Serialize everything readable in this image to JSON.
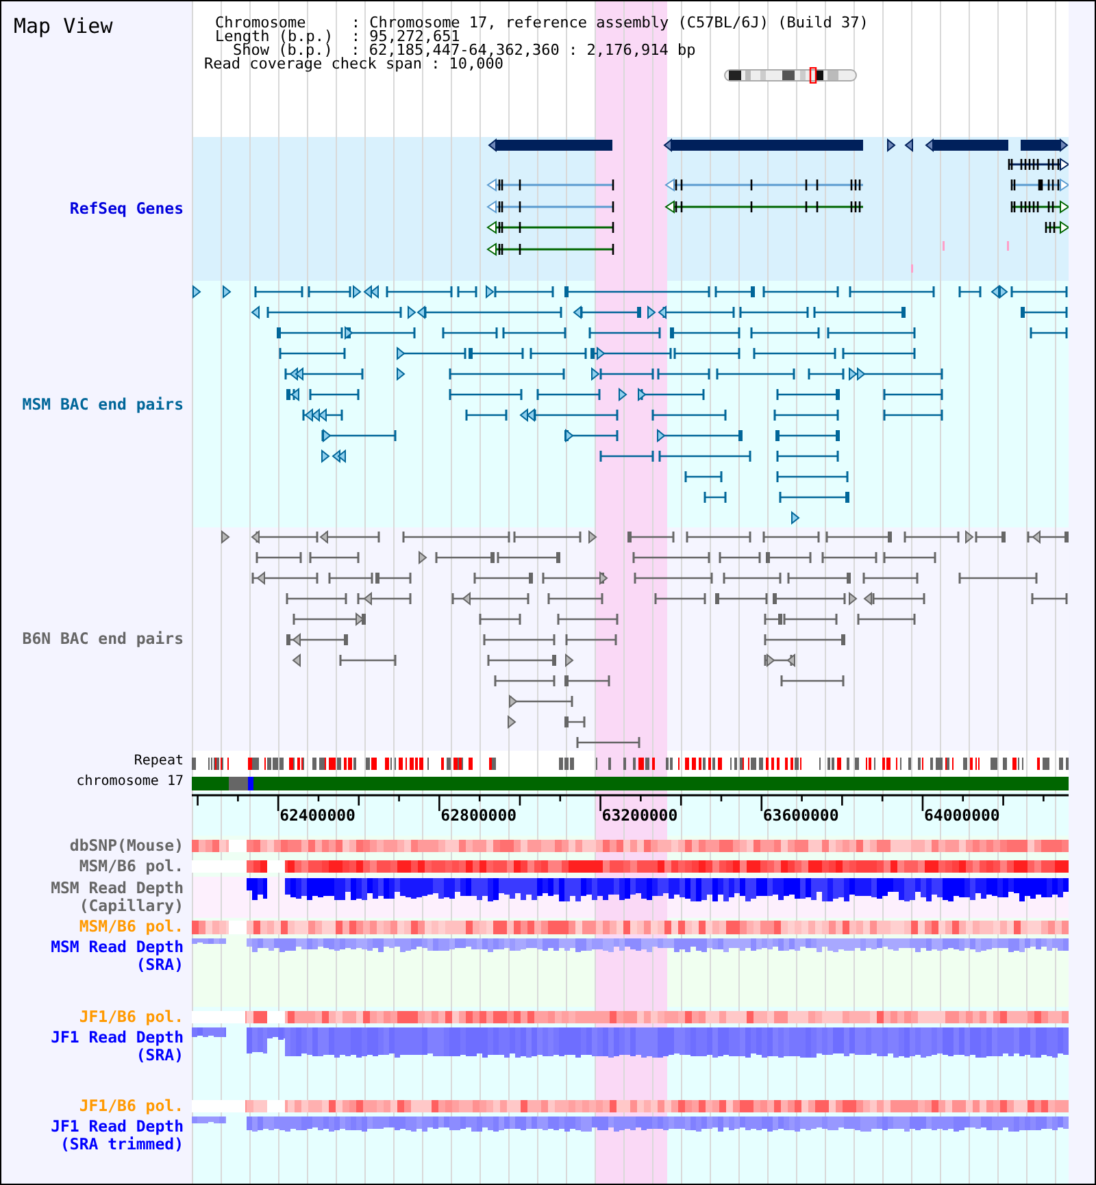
{
  "title": "Map View",
  "info": [
    "Chromosome     : Chromosome 17, reference assembly (C57BL/6J) (Build 37)",
    "Length (b.p.)  : 95,272,651",
    "Show (b.p.)  : 62,185,447-64,362,360 : 2,176,914 bp",
    "Read coverage check span : 10,000"
  ],
  "tracks": [
    {
      "kind": "genes",
      "label": "RefSeq Genes",
      "color": "#0000dd",
      "bold": true
    },
    {
      "kind": "pairs",
      "label": "MSM BAC end pairs",
      "color": "#006699",
      "bold": true
    },
    {
      "kind": "pairs",
      "label": "B6N BAC end pairs",
      "color": "#666666",
      "bold": true
    },
    {
      "kind": "repeat",
      "label": "Repeat",
      "color": "#000000",
      "bold": false
    },
    {
      "kind": "chromosome",
      "label": "chromosome 17",
      "color": "#000000",
      "bold": false
    },
    {
      "kind": "axis",
      "ticks": [
        "62400000",
        "62800000",
        "63200000",
        "63600000",
        "64000000"
      ]
    },
    {
      "kind": "heatmap",
      "label": "dbSNP(Mouse)",
      "color": "#666666",
      "bold": true
    },
    {
      "kind": "heatmap",
      "label": "MSM/B6 pol.",
      "color": "#666666",
      "bold": true
    },
    {
      "kind": "depth",
      "label": "MSM Read Depth (Capillary)",
      "color": "#666666",
      "bold": true
    },
    {
      "kind": "heatmap",
      "label": "MSM/B6 pol.",
      "color": "#ff9900",
      "bold": true
    },
    {
      "kind": "depth",
      "label": "MSM Read Depth (SRA)",
      "color": "#0000ff",
      "bold": true
    },
    {
      "kind": "heatmap",
      "label": "JF1/B6 pol.",
      "color": "#ff9900",
      "bold": true
    },
    {
      "kind": "depth",
      "label": "JF1 Read Depth (SRA)",
      "color": "#0000ff",
      "bold": true
    },
    {
      "kind": "heatmap",
      "label": "JF1/B6 pol.",
      "color": "#ff9900",
      "bold": true
    },
    {
      "kind": "depth",
      "label": "JF1 Read Depth (SRA trimmed)",
      "color": "#0000ff",
      "bold": true
    }
  ]
}
